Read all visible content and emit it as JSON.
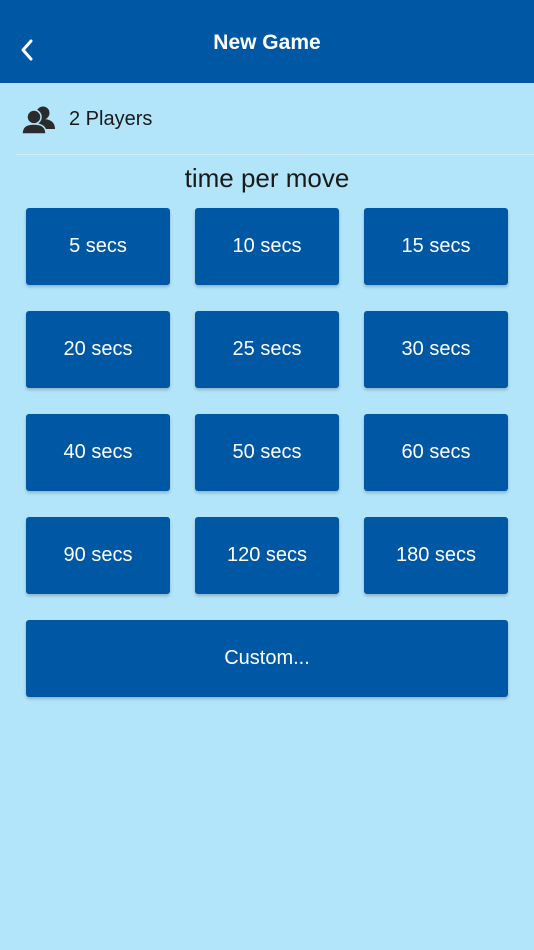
{
  "header": {
    "title": "New Game",
    "back_icon": "chevron-left-icon"
  },
  "players": {
    "icon": "players-icon",
    "label": "2 Players"
  },
  "section_title": "time per move",
  "time_options": [
    "5 secs",
    "10 secs",
    "15 secs",
    "20 secs",
    "25 secs",
    "30 secs",
    "40 secs",
    "50 secs",
    "60 secs",
    "90 secs",
    "120 secs",
    "180 secs"
  ],
  "custom_label": "Custom...",
  "colors": {
    "header": "#0057a3",
    "background": "#b3e5fa",
    "button": "#0057a3",
    "button_text": "#ffffff"
  }
}
